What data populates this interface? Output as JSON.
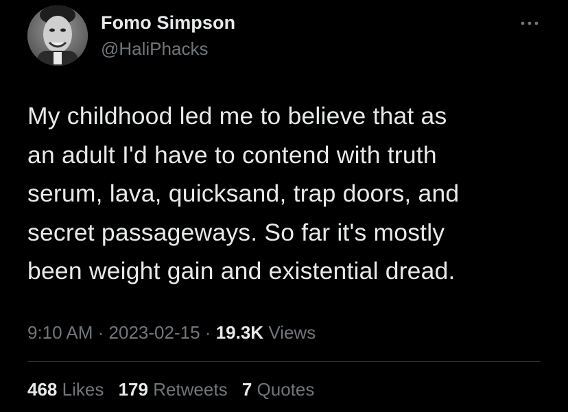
{
  "author": {
    "name": "Fomo Simpson",
    "handle": "@HaliPhacks"
  },
  "tweet": {
    "lines": [
      "My childhood led me to believe that as",
      "an adult I'd have to contend with truth",
      "serum, lava, quicksand, trap doors, and",
      "secret passageways. So far it's mostly",
      "been weight gain and existential dread."
    ]
  },
  "meta": {
    "time": "9:10 AM",
    "separator": "·",
    "date": "2023-02-15",
    "views_count": "19.3K",
    "views_label": "Views"
  },
  "stats": {
    "likes_count": "468",
    "likes_label": "Likes",
    "retweets_count": "179",
    "retweets_label": "Retweets",
    "quotes_count": "7",
    "quotes_label": "Quotes"
  },
  "icons": {
    "more": "more-horizontal-icon"
  },
  "colors": {
    "background": "#000000",
    "primary_text": "#e7e9ea",
    "secondary_text": "#71767b",
    "divider": "#2f3336"
  }
}
